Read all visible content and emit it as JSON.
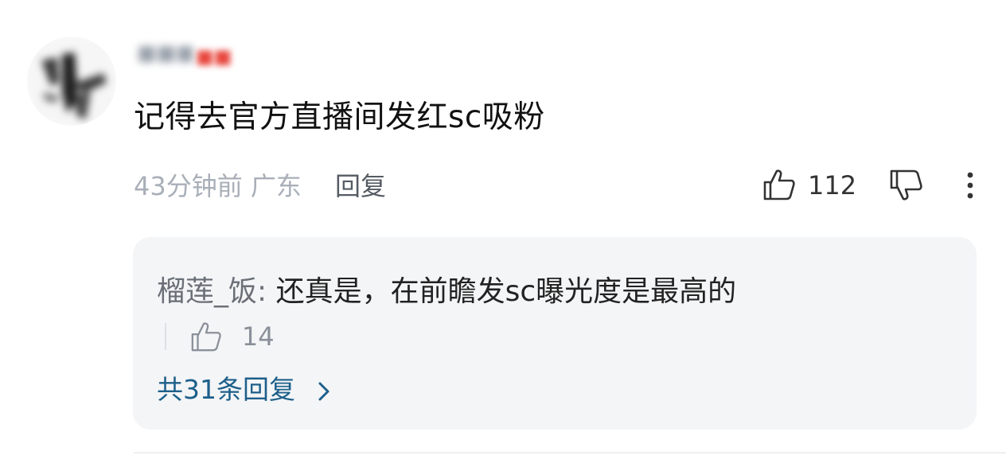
{
  "comment": {
    "author": "■■■",
    "level_badge": "■■",
    "text": "记得去官方直播间发红sc吸粉",
    "time_location": "43分钟前 广东",
    "reply_label": "回复",
    "like_count": "112",
    "icons": {
      "like": "thumbs-up-icon",
      "dislike": "thumbs-down-icon",
      "more": "more-vertical-icon"
    }
  },
  "replies": {
    "top_reply": {
      "author": "榴莲_饭:",
      "text": "还真是，在前瞻发sc曝光度是最高的",
      "like_count": "14"
    },
    "view_all_label": "共31条回复",
    "icons": {
      "chevron": "chevron-right-icon"
    }
  },
  "colors": {
    "link": "#1d5f8a",
    "meta": "#a9afb8",
    "reply_bg": "#f4f5f7",
    "badge": "#e8453c"
  }
}
